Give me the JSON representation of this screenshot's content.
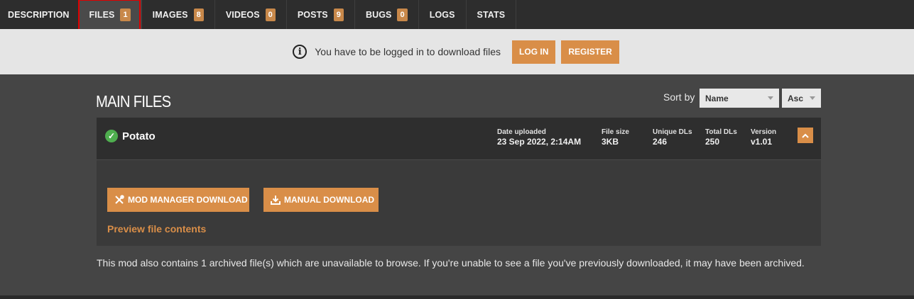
{
  "tabs": [
    {
      "label": "DESCRIPTION",
      "badge": ""
    },
    {
      "label": "FILES",
      "badge": "1"
    },
    {
      "label": "IMAGES",
      "badge": "8"
    },
    {
      "label": "VIDEOS",
      "badge": "0"
    },
    {
      "label": "POSTS",
      "badge": "9"
    },
    {
      "label": "BUGS",
      "badge": "0"
    },
    {
      "label": "LOGS",
      "badge": ""
    },
    {
      "label": "STATS",
      "badge": ""
    }
  ],
  "login_bar": {
    "info_icon": "info-icon",
    "message": "You have to be logged in to download files",
    "login_label": "LOG IN",
    "register_label": "REGISTER"
  },
  "main": {
    "title": "MAIN FILES",
    "sort_label": "Sort by",
    "sort_field": "Name",
    "sort_order": "Asc"
  },
  "file": {
    "name": "Potato",
    "status_icon": "check-circle-icon",
    "date_label": "Date uploaded",
    "date_value": "23 Sep 2022, 2:14AM",
    "size_label": "File size",
    "size_value": "3KB",
    "unique_label": "Unique DLs",
    "unique_value": "246",
    "total_label": "Total DLs",
    "total_value": "250",
    "version_label": "Version",
    "version_value": "v1.01",
    "mod_manager_label": "MOD MANAGER DOWNLOAD",
    "manual_label": "MANUAL DOWNLOAD",
    "preview_label": "Preview file contents"
  },
  "archive_note": "This mod also contains 1 archived file(s) which are unavailable to browse. If you're unable to see a file you've previously downloaded, it may have been archived.",
  "colors": {
    "accent": "#d98e48",
    "success": "#4fae4f"
  }
}
